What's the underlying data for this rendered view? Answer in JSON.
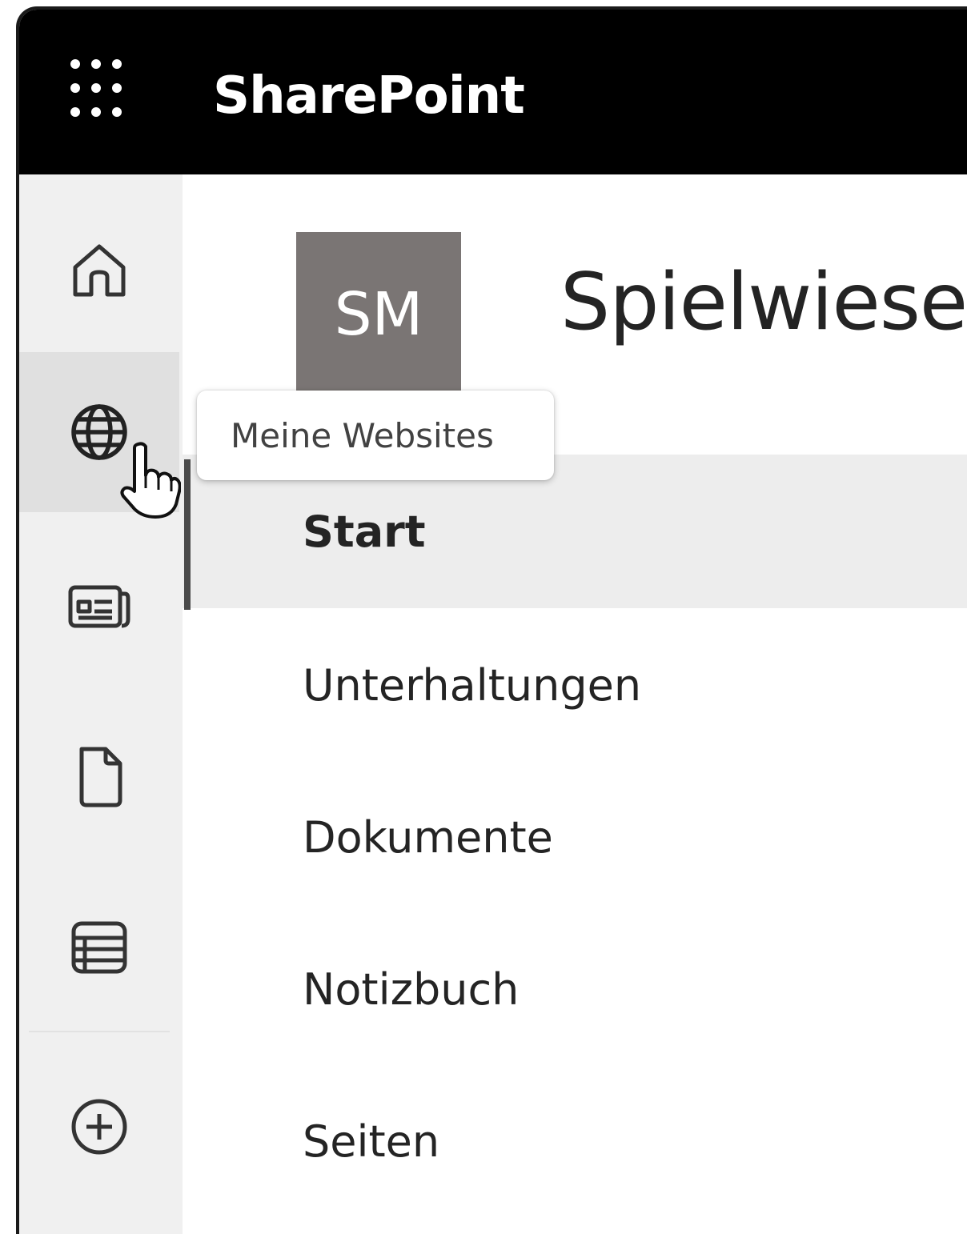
{
  "suitebar": {
    "app_title": "SharePoint"
  },
  "rail": {
    "items": [
      {
        "name": "home",
        "icon": "home-icon"
      },
      {
        "name": "my-sites",
        "icon": "globe-icon",
        "state": "hover"
      },
      {
        "name": "news",
        "icon": "news-icon"
      },
      {
        "name": "files",
        "icon": "document-icon"
      },
      {
        "name": "lists",
        "icon": "list-icon"
      },
      {
        "name": "create",
        "icon": "add-circle-icon"
      }
    ],
    "tooltip": "Meine Websites"
  },
  "site": {
    "logo_initials": "SM",
    "logo_color": "#7a7574",
    "title": "Spielwiese"
  },
  "nav": {
    "items": [
      {
        "label": "Start",
        "selected": true
      },
      {
        "label": "Unterhaltungen"
      },
      {
        "label": "Dokumente"
      },
      {
        "label": "Notizbuch"
      },
      {
        "label": "Seiten"
      }
    ]
  }
}
